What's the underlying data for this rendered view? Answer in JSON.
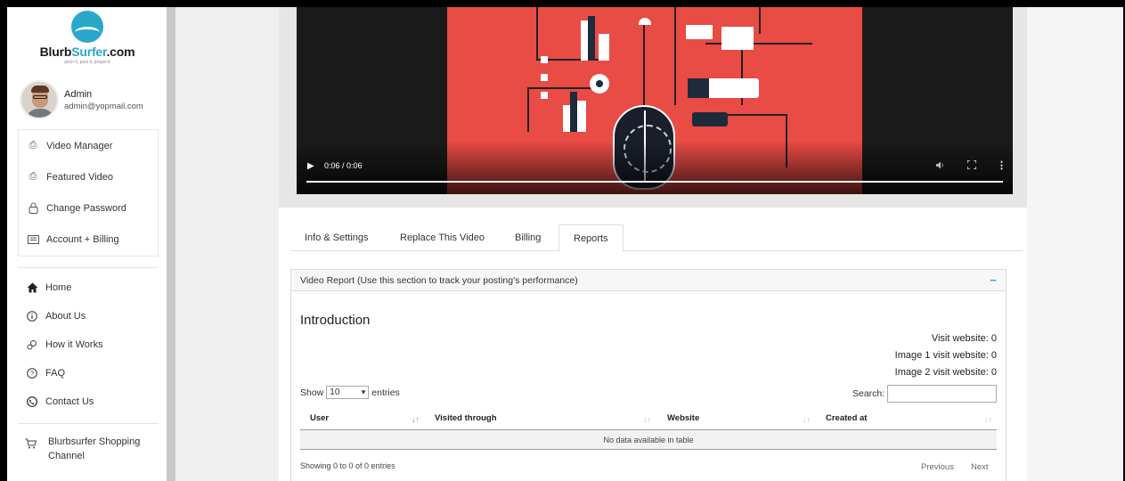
{
  "brand": {
    "logo_primary": "Blurb",
    "logo_accent": "Surfer",
    "logo_suffix": ".com",
    "tagline": "pitch it, post it, propel it",
    "accent_color": "#2aa7c9"
  },
  "user": {
    "name": "Admin",
    "email": "admin@yopmail.com"
  },
  "sidebar": {
    "account_items": [
      {
        "label": "Video Manager",
        "icon": "video-icon"
      },
      {
        "label": "Featured Video",
        "icon": "video-icon"
      },
      {
        "label": "Change Password",
        "icon": "lock-icon"
      },
      {
        "label": "Account + Billing",
        "icon": "billing-icon"
      }
    ],
    "nav_items": [
      {
        "label": "Home",
        "icon": "home-icon"
      },
      {
        "label": "About Us",
        "icon": "info-icon"
      },
      {
        "label": "How it Works",
        "icon": "gears-icon"
      },
      {
        "label": "FAQ",
        "icon": "question-icon"
      },
      {
        "label": "Contact Us",
        "icon": "phone-icon"
      }
    ],
    "shop_label": "Blurbsurfer Shopping Channel"
  },
  "video": {
    "time": "0:06 / 0:06",
    "progress": 1.0
  },
  "tabs": [
    {
      "label": "Info & Settings",
      "active": false
    },
    {
      "label": "Replace This Video",
      "active": false
    },
    {
      "label": "Billing",
      "active": false
    },
    {
      "label": "Reports",
      "active": true
    }
  ],
  "report": {
    "heading": "Video Report (Use this section to track your posting's performance)",
    "collapse_symbol": "−",
    "intro_title": "Introduction",
    "stats": [
      "Visit website: 0",
      "Image 1 visit website: 0",
      "Image 2 visit website: 0"
    ],
    "show_label": "Show",
    "entries_value": "10",
    "entries_label": "entries",
    "search_label": "Search:",
    "columns": [
      "User",
      "Visited through",
      "Website",
      "Created at"
    ],
    "empty_text": "No data available in table",
    "info_text": "Showing 0 to 0 of 0 entries",
    "prev_label": "Previous",
    "next_label": "Next"
  }
}
